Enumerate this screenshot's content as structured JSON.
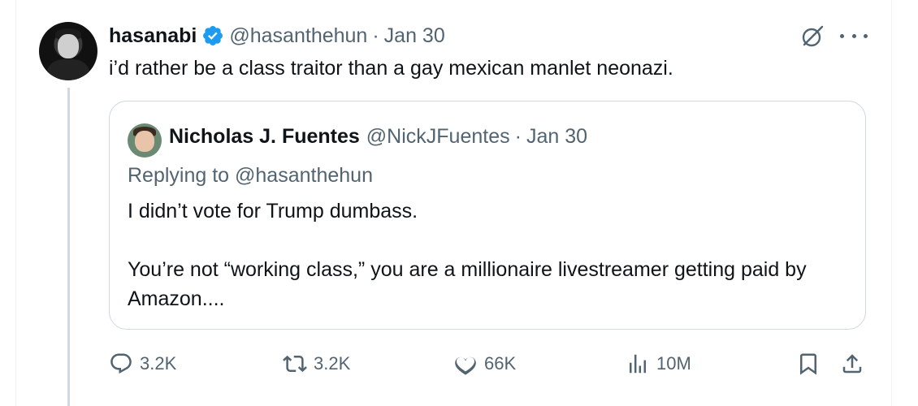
{
  "tweet": {
    "author_name": "hasanabi",
    "author_handle": "@hasanthehun",
    "separator": "·",
    "date": "Jan 30",
    "text": "i’d rather be a class traitor than a gay mexican manlet neonazi."
  },
  "quoted_tweet": {
    "author_name": "Nicholas J. Fuentes",
    "author_handle": "@NickJFuentes",
    "separator": "·",
    "date": "Jan 30",
    "replying_to": "Replying to @hasanthehun",
    "line1": "I didn’t vote for Trump dumbass.",
    "line2": "You’re not “working class,” you are a millionaire livestreamer getting paid by Amazon...."
  },
  "actions": {
    "replies": "3.2K",
    "retweets": "3.2K",
    "likes": "66K",
    "views": "10M"
  },
  "colors": {
    "verified": "#1d9bf0",
    "secondary_text": "#536471",
    "border": "#cfd9de"
  }
}
